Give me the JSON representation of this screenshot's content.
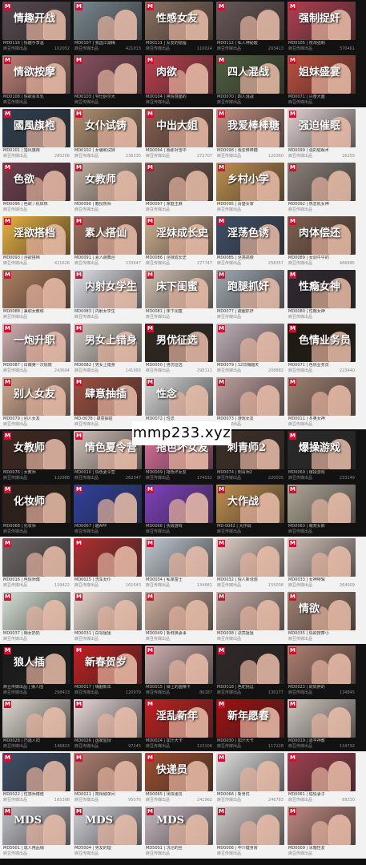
{
  "watermark": "mmp233.xyz",
  "bands": [
    {
      "theme": "dark",
      "rows": [
        [
          {
            "code": "MD0116",
            "title": "MD0116 | 情趣手李温",
            "views": "102052",
            "cap": "情趣开战",
            "bg": "#5a4a52"
          },
          {
            "code": "MD0107",
            "title": "MD0107 | 我国江湖梅",
            "views": "421013",
            "cap": "",
            "bg": "#7a8890"
          },
          {
            "code": "MD0111",
            "title": "MD0111 | 女友的偷擅",
            "views": "110024",
            "cap": "性感女友",
            "bg": "#8a7060"
          },
          {
            "code": "MD0112",
            "title": "MD0112 | 私人神秘酸",
            "views": "203413",
            "cap": "",
            "bg": "#6a5858"
          },
          {
            "code": "MD0105",
            "title": "MD0105 | 权淘强制",
            "views": "370461",
            "cap": "强制捉奸",
            "bg": "#b04050"
          }
        ],
        [
          {
            "code": "MD0108",
            "title": "MD0108 | 情欲会本乳",
            "views": "",
            "cap": "情欲按摩",
            "bg": "#c08078"
          },
          {
            "code": "MD0103",
            "title": "MD0103 | 爷仕卧尔大",
            "views": "",
            "cap": "",
            "bg": "#8a5060"
          },
          {
            "code": "MD0104",
            "title": "MD0104 | 换情感面的",
            "views": "",
            "cap": "肉欲",
            "bg": "#c04050"
          },
          {
            "code": "MD0070",
            "title": "MD0070 | 四人混战",
            "views": "",
            "cap": "四人混战",
            "bg": "#506040"
          },
          {
            "code": "MD0071",
            "title": "MD0071 | 兴奋大面",
            "views": "",
            "cap": "姐妹盛宴",
            "bg": "#c05040"
          }
        ]
      ]
    },
    {
      "theme": "light",
      "rows": [
        [
          {
            "code": "MD0101",
            "title": "MD0101 | 猎风旗袍",
            "views": "285208",
            "cap": "國風旗袍",
            "bg": "#304050"
          },
          {
            "code": "MD0102",
            "title": "MD0102 | 女编和试妹",
            "views": "236335",
            "cap": "女仆试铸",
            "bg": "#b09070"
          },
          {
            "code": "MD0094",
            "title": "MD0094 | 我那对雪中",
            "views": "272707",
            "cap": "中出大姐",
            "bg": "#8a6050"
          },
          {
            "code": "MD0098",
            "title": "MD0098 | 我爱棒棒糖",
            "views": "120360",
            "cap": "我爱棒棒糖",
            "bg": "#c09080"
          },
          {
            "code": "MD0099",
            "title": "MD0099 | 强的催眠术",
            "views": "26255",
            "cap": "强迫催眠",
            "bg": "#e0d0d0"
          }
        ],
        [
          {
            "code": "MD0096",
            "title": "MD0096 | 色欲 / 机体热",
            "views": "",
            "cap": "色欲",
            "bg": "#704050"
          },
          {
            "code": "MD0090",
            "title": "MD0090 | 教授热师",
            "views": "",
            "cap": "女教师",
            "bg": "#c0b0a0"
          },
          {
            "code": "MD0097",
            "title": "MD0097 | 家庭主麻",
            "views": "",
            "cap": "",
            "bg": "#7a6058"
          },
          {
            "code": "MD0095",
            "title": "MD0095 | 清楚女家",
            "views": "",
            "cap": "乡村小学",
            "bg": "#c09050"
          },
          {
            "code": "MD0092",
            "title": "MD0092 | 热恋机女神",
            "views": "",
            "cap": "",
            "bg": "#8a8078"
          }
        ]
      ]
    },
    {
      "theme": "light",
      "rows": [
        [
          {
            "code": "MD0093",
            "title": "MD0093 | 淫欲搭档",
            "views": "421626",
            "cap": "淫欲搭档",
            "bg": "#e8b040"
          },
          {
            "code": "MD0091",
            "title": "MD0091 | 素人跳舞台",
            "views": "233647",
            "cap": "素人搭讪",
            "bg": "#a07060"
          },
          {
            "code": "MD0086",
            "title": "MD0086 | 淫妹成长史",
            "views": "277747",
            "cap": "淫妹成长史",
            "bg": "#d0b090"
          },
          {
            "code": "MD0085",
            "title": "MD0085 | 淫荡高楼",
            "views": "258357",
            "cap": "淫荡色诱",
            "bg": "#405068"
          },
          {
            "code": "MD0089",
            "title": "MD0089 | 女调牛牛的",
            "views": "486895",
            "cap": "肉体偿还",
            "bg": "#806050"
          }
        ],
        [
          {
            "code": "MD0088",
            "title": "MD0088 | 兼职女教练",
            "views": "",
            "cap": "",
            "bg": "#b08060"
          },
          {
            "code": "MD0083",
            "title": "MD0083 | 内射女学生",
            "views": "",
            "cap": "内射女学生",
            "bg": "#e0e0e8"
          },
          {
            "code": "MD0081",
            "title": "MD0081 | 床下闺蜜",
            "views": "",
            "cap": "床下闺蜜",
            "bg": "#d0c0b0"
          },
          {
            "code": "MD0077",
            "title": "MD0077 | 跑腿抓奸",
            "views": "",
            "cap": "跑腿抓奸",
            "bg": "#a0a8b0"
          },
          {
            "code": "MD0080",
            "title": "MD0080 | 性瘾女神",
            "views": "",
            "cap": "性瘾女神",
            "bg": "#302830"
          }
        ]
      ]
    },
    {
      "theme": "light",
      "rows": [
        [
          {
            "code": "MD0087",
            "title": "MD0087 | 白嫩第一次偷窥",
            "views": "243694",
            "cap": "一炮升职",
            "bg": "#d0b0b0"
          },
          {
            "code": "MD0082",
            "title": "MD0082 | 男女上错身",
            "views": "141993",
            "cap": "男女上错身",
            "bg": "#d0c8c0"
          },
          {
            "code": "MD0050",
            "title": "MD0050 | 男优征选",
            "views": "298111",
            "cap": "男优征选",
            "bg": "#302820"
          },
          {
            "code": "MD0079",
            "title": "MD0079 | 12日嗨翻天",
            "views": "208882",
            "cap": "",
            "bg": "#c0b0b8"
          },
          {
            "code": "MD0071",
            "title": "MD0071 | 色情业务员",
            "views": "223440",
            "cap": "色情业务员",
            "bg": "#201810"
          }
        ],
        [
          {
            "code": "MD0079",
            "title": "MD0079 | 别人女友",
            "views": "",
            "cap": "别人女友",
            "bg": "#d0a890"
          },
          {
            "code": "MD0078",
            "title": "MD-0078 | 肆意抽插",
            "views": "",
            "cap": "肆意抽插",
            "bg": "#a05040"
          },
          {
            "code": "MD0072",
            "title": "MD0072 | 性念",
            "views": "",
            "cap": "性念",
            "bg": "#d8d8d8"
          },
          {
            "code": "MD0073",
            "title": "MD0073 | 游戏女友",
            "views": "",
            "cap": "",
            "bg": "#c0a0a0"
          },
          {
            "code": "MD0011",
            "title": "MD0011 | 冬奥女神",
            "views": "",
            "cap": "",
            "bg": "#a08070"
          }
        ]
      ]
    },
    {
      "theme": "dark",
      "rows": [
        [
          {
            "code": "MD0076",
            "title": "MD0076 | 女教师",
            "views": "132988",
            "cap": "女教师",
            "bg": "#402820"
          },
          {
            "code": "MD0010",
            "title": "MD0010 | 情色夏令营",
            "views": "262347",
            "cap": "情色夏令营",
            "bg": "#d0c0b8"
          },
          {
            "code": "MD0009",
            "title": "MD0009 | 拖色坏女友",
            "views": "174032",
            "cap": "拖色坏女友",
            "bg": "#e070a0"
          },
          {
            "code": "MD0074",
            "title": "MD0074 | 刺青师2",
            "views": "220035",
            "cap": "刺青师2",
            "bg": "#403028"
          },
          {
            "code": "MD0069",
            "title": "MD0069 | 爆操游戏",
            "views": "233149",
            "cap": "爆操游戏",
            "bg": "#2a2a2a"
          }
        ],
        [
          {
            "code": "MD0068",
            "title": "MD0068 | 化妆师",
            "views": "",
            "cap": "化妆师",
            "bg": "#302018"
          },
          {
            "code": "MD0067",
            "title": "MD0067 | 趣APP",
            "views": "",
            "cap": "",
            "bg": "#3040a0"
          },
          {
            "code": "MD0066",
            "title": "MD0066 | 实践游戏",
            "views": "",
            "cap": "",
            "bg": "#8040c0"
          },
          {
            "code": "MD0062",
            "title": "MD-0062 | 大作战",
            "views": "",
            "cap": "大作战",
            "bg": "#c09050"
          },
          {
            "code": "MD0063",
            "title": "MD0063 | 萌宠女郎",
            "views": "",
            "cap": "",
            "bg": "#b0a898"
          }
        ]
      ]
    },
    {
      "theme": "light",
      "rows": [
        [
          {
            "code": "MD0016",
            "title": "MD0016 | 色情师傅",
            "views": "129422",
            "cap": "",
            "bg": "#706868"
          },
          {
            "code": "MD0025",
            "title": "MD0025 | 洗车女仆",
            "views": "161543",
            "cap": "",
            "bg": "#b03030"
          },
          {
            "code": "MD0034",
            "title": "MD0034 | 私家富士",
            "views": "134681",
            "cap": "",
            "bg": "#c0c8d0"
          },
          {
            "code": "MD0032",
            "title": "MD0032 | 情人新诱惑",
            "views": "155038",
            "cap": "",
            "bg": "#e0d0c8"
          },
          {
            "code": "MD0033",
            "title": "MD0033 | 女神特辑",
            "views": "264009",
            "cap": "",
            "bg": "#d0c0b8"
          }
        ],
        [
          {
            "code": "MD0037",
            "title": "MD0037 | 痴女奶奶",
            "views": "",
            "cap": "",
            "bg": "#d8e0d8"
          },
          {
            "code": "MD0031",
            "title": "MD0031 | 白领姐姐",
            "views": "",
            "cap": "",
            "bg": "#e8d8d0"
          },
          {
            "code": "MD0049",
            "title": "MD0049 | 新鲜换妻事",
            "views": "",
            "cap": "",
            "bg": "#d0b0a0"
          },
          {
            "code": "MD0038",
            "title": "MD0038 | 漂亮姐姐",
            "views": "",
            "cap": "",
            "bg": "#c8b0a8"
          },
          {
            "code": "MD0035",
            "title": "MD0035 | 情欲按摩小",
            "views": "",
            "cap": "情欲",
            "bg": "#a08070"
          }
        ]
      ]
    },
    {
      "theme": "dark",
      "rows": [
        [
          {
            "code": "MD0014",
            "title": "麻豆传媒出品 | 狼人插",
            "views": "298413",
            "cap": "狼人插",
            "bg": "#1a1a1a"
          },
          {
            "code": "MD0017",
            "title": "MD0017 | 嗨翻新年",
            "views": "120979",
            "cap": "新春贺岁",
            "bg": "#c02020"
          },
          {
            "code": "MD0015",
            "title": "MD0015 | 婶上的画精卡",
            "views": "86187",
            "cap": "",
            "bg": "#d0b0b0"
          },
          {
            "code": "MD0018",
            "title": "MD0018 | 色蛇挑逗",
            "views": "130177",
            "cap": "",
            "bg": "#302828"
          },
          {
            "code": "MD0023",
            "title": "MD0023 | 欲奴胖的",
            "views": "134845",
            "cap": "",
            "bg": "#b08070"
          }
        ],
        [
          {
            "code": "MD0028",
            "title": "MD0028 | 巧遇人妇",
            "views": "146823",
            "cap": "",
            "bg": "#e0d8d0"
          },
          {
            "code": "MD0026",
            "title": "MD0026 | 国家监狱",
            "views": "97245",
            "cap": "",
            "bg": "#e8d8d8"
          },
          {
            "code": "MD0024",
            "title": "MD0024 | 加汁大卡",
            "views": "123108",
            "cap": "淫乱新年",
            "bg": "#c02020"
          },
          {
            "code": "MD0030",
            "title": "MD0030 | 加汁大卡",
            "views": "117228",
            "cap": "新年愿春",
            "bg": "#a01010"
          },
          {
            "code": "MD0019",
            "title": "MD0019 | 退学神教",
            "views": "134792",
            "cap": "",
            "bg": "#d0c8c0"
          }
        ]
      ]
    },
    {
      "theme": "light",
      "rows": [
        [
          {
            "code": "MD0022",
            "title": "MD0022 | 性感师傅陪",
            "views": "165398",
            "cap": "",
            "bg": "#405068"
          },
          {
            "code": "MD0021",
            "title": "MD0021 | 简阳城单问",
            "views": "95076",
            "cap": "",
            "bg": "#b08070"
          },
          {
            "code": "MD0065",
            "title": "MD0065 | 出快递员",
            "views": "241962",
            "cap": "快递员",
            "bg": "#a05030"
          },
          {
            "code": "MD0066",
            "title": "MD0066 | 新男优",
            "views": "246783",
            "cap": "",
            "bg": "#e0e0e0"
          },
          {
            "code": "MD0061",
            "title": "MD0061 | 偷情妻子",
            "views": "89330",
            "cap": "",
            "bg": "#a04050"
          }
        ],
        [
          {
            "code": "MD5001",
            "title": "MD5001 | 成人用品销",
            "views": "",
            "cap": "MDS",
            "bg": "#c0c0c8"
          },
          {
            "code": "MD5004",
            "title": "MD5004 | 男友的理",
            "views": "",
            "cap": "MDS",
            "bg": "#d0d0d8"
          },
          {
            "code": "MD5001b",
            "title": "MD5001 | 沉沦的丝",
            "views": "",
            "cap": "MDS",
            "bg": "#c8b8c0"
          },
          {
            "code": "MD0006",
            "title": "MD0006 | 中介健身房",
            "views": "",
            "cap": "",
            "bg": "#d0c8c8"
          },
          {
            "code": "MD0009",
            "title": "MD0009 | 冰箱性爱",
            "views": "",
            "cap": "",
            "bg": "#c08880"
          }
        ]
      ]
    }
  ],
  "card_footer_left": "麻豆传媒出品",
  "logo_letter": "M"
}
